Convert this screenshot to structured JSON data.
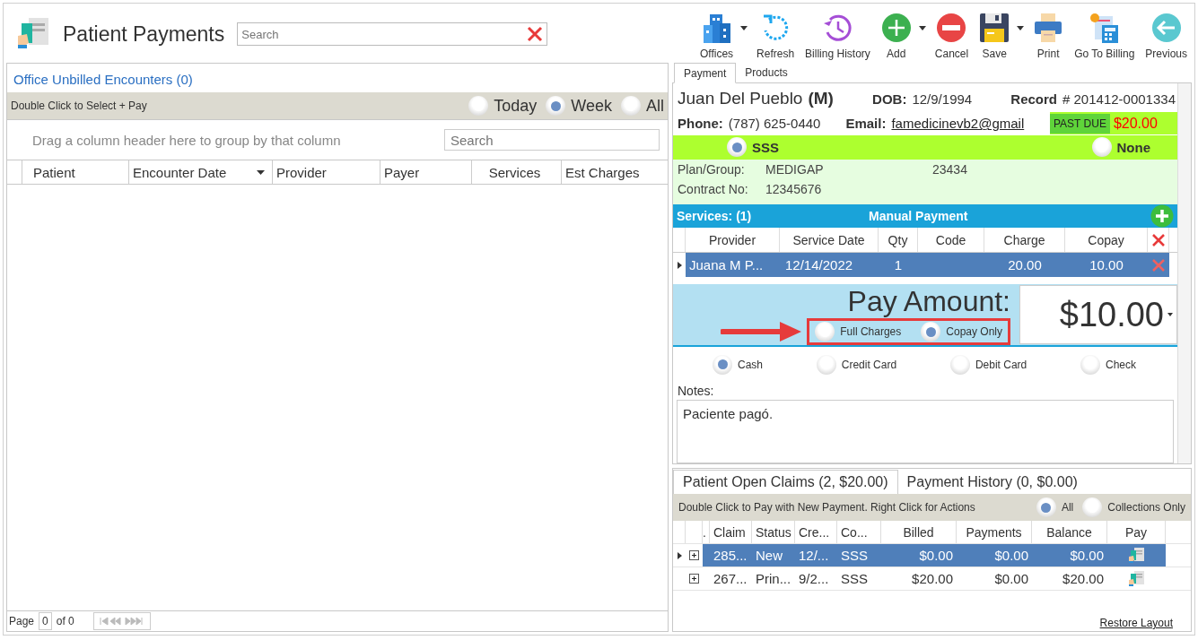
{
  "app": {
    "title": "Patient Payments",
    "search": {
      "placeholder": "Search"
    }
  },
  "toolbar": [
    {
      "label": "Offices",
      "kind": "buildings",
      "dropdown": true
    },
    {
      "label": "Refresh",
      "kind": "refresh",
      "dropdown": false
    },
    {
      "label": "Billing History",
      "kind": "history",
      "dropdown": false
    },
    {
      "label": "Add",
      "kind": "add",
      "dropdown": true
    },
    {
      "label": "Cancel",
      "kind": "cancel",
      "dropdown": false
    },
    {
      "label": "Save",
      "kind": "save",
      "dropdown": true
    },
    {
      "label": "Print",
      "kind": "print",
      "dropdown": false
    },
    {
      "label": "Go To Billing",
      "kind": "billing",
      "dropdown": false
    },
    {
      "label": "Previous",
      "kind": "previous",
      "dropdown": false
    }
  ],
  "encounters": {
    "title": "Office Unbilled Encounters (0)",
    "hint": "Double Click to Select + Pay",
    "filters": [
      {
        "label": "Today",
        "selected": false
      },
      {
        "label": "Week",
        "selected": true
      },
      {
        "label": "All",
        "selected": false
      }
    ],
    "group_hint": "Drag a column header here to group by that column",
    "search": {
      "placeholder": "Search"
    },
    "columns": [
      {
        "label": "Patient",
        "sorted": false
      },
      {
        "label": "Encounter Date",
        "sorted": true
      },
      {
        "label": "Provider",
        "sorted": false
      },
      {
        "label": "Payer",
        "sorted": false
      },
      {
        "label": "Services",
        "sorted": false
      },
      {
        "label": "Est Charges",
        "sorted": false
      }
    ],
    "pager": {
      "label": "Page",
      "page": "0",
      "total": "of 0"
    }
  },
  "tabs": [
    {
      "label": "Payment",
      "selected": true
    },
    {
      "label": "Products",
      "selected": false
    }
  ],
  "patient": {
    "name": "Juan Del Pueblo",
    "sex": "(M)",
    "dob_label": "DOB:",
    "dob": "12/9/1994",
    "record_label": "Record",
    "record": "# 201412-0001334",
    "phone_label": "Phone:",
    "phone": "(787) 625-0440",
    "email_label": "Email:",
    "email": "famedicinevb2@gmail",
    "past_due_label": "PAST DUE",
    "past_due": "$20.00"
  },
  "insurance": {
    "options": [
      {
        "label": "SSS",
        "selected": true
      },
      {
        "label": "None",
        "selected": false
      }
    ],
    "plan_label": "Plan/Group:",
    "plan": "MEDIGAP",
    "group": "23434",
    "contract_label": "Contract No:",
    "contract": "12345676"
  },
  "services": {
    "title": "Services: (1)",
    "mode": "Manual Payment",
    "columns": [
      "Provider",
      "Service Date",
      "Qty",
      "Code",
      "Charge",
      "Copay"
    ],
    "rows": [
      {
        "selected": true,
        "provider": "Juana M P...",
        "service_date": "12/14/2022",
        "qty": "1",
        "charge": "20.00",
        "copay": "10.00"
      }
    ]
  },
  "pay": {
    "label": "Pay Amount:",
    "amount": "$10.00",
    "basis": [
      {
        "label": "Full Charges",
        "selected": false
      },
      {
        "label": "Copay Only",
        "selected": true
      }
    ],
    "methods": [
      {
        "label": "Cash",
        "selected": true
      },
      {
        "label": "Credit Card",
        "selected": false
      },
      {
        "label": "Debit Card",
        "selected": false
      },
      {
        "label": "Check",
        "selected": false
      }
    ]
  },
  "notes": {
    "label": "Notes:",
    "value": "Paciente pagó."
  },
  "claim_tabs": [
    {
      "label": "Patient Open Claims (2, $20.00)",
      "selected": true
    },
    {
      "label": "Payment History (0, $0.00)",
      "selected": false
    }
  ],
  "claims": {
    "hint": "Double Click to Pay with New Payment. Right Click for Actions",
    "filters": [
      {
        "label": "All",
        "selected": true
      },
      {
        "label": "Collections Only",
        "selected": false
      }
    ],
    "columns": [
      ".",
      "Claim",
      "Status",
      "Cre...",
      "Co...",
      "Billed",
      "Payments",
      "Balance",
      "Pay"
    ],
    "rows": [
      {
        "selected": true,
        "cells": [
          "",
          "285...",
          "New",
          "12/...",
          "SSS",
          "$0.00",
          "$0.00",
          "$0.00"
        ]
      },
      {
        "selected": false,
        "cells": [
          "",
          "267...",
          "Prin...",
          "9/2...",
          "SSS",
          "$20.00",
          "$0.00",
          "$20.00"
        ]
      }
    ],
    "restore": "Restore Layout"
  }
}
